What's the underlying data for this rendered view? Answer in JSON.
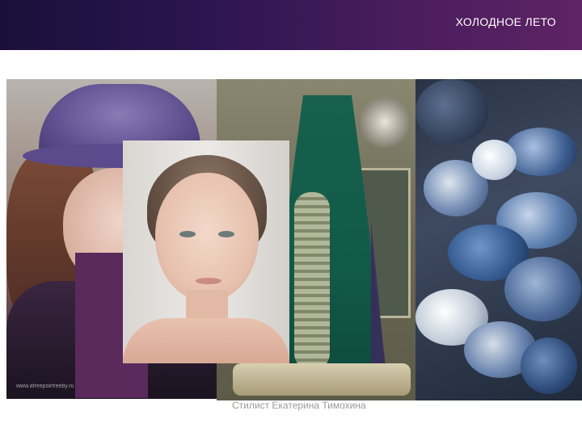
{
  "slide": {
    "title": "ХОЛОДНОЕ ЛЕТО",
    "credit": "Стилист Екатерина Тимохина",
    "watermark": "www.afreepoirtreeby.ru"
  },
  "colors": {
    "header_gradient_start": "#1a0f3a",
    "header_gradient_end": "#5e2364",
    "title_text": "#ffffff",
    "credit_text": "#9a9a9a"
  }
}
